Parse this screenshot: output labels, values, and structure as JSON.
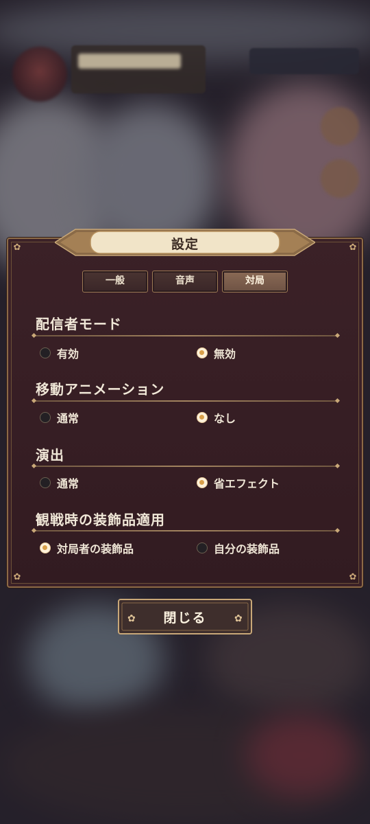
{
  "dialog": {
    "title": "設定",
    "tabs": [
      {
        "label": "一般",
        "active": false
      },
      {
        "label": "音声",
        "active": false
      },
      {
        "label": "対局",
        "active": true
      }
    ],
    "sections": [
      {
        "title": "配信者モード",
        "options": [
          {
            "label": "有効",
            "selected": false
          },
          {
            "label": "無効",
            "selected": true
          }
        ]
      },
      {
        "title": "移動アニメーション",
        "options": [
          {
            "label": "通常",
            "selected": false
          },
          {
            "label": "なし",
            "selected": true
          }
        ]
      },
      {
        "title": "演出",
        "options": [
          {
            "label": "通常",
            "selected": false
          },
          {
            "label": "省エフェクト",
            "selected": true
          }
        ]
      },
      {
        "title": "観戦時の装飾品適用",
        "options": [
          {
            "label": "対局者の装飾品",
            "selected": true
          },
          {
            "label": "自分の装飾品",
            "selected": false
          }
        ]
      }
    ],
    "close_label": "閉じる"
  },
  "colors": {
    "panel": "#3b2127",
    "border": "#8c6a46",
    "accent": "#d9a04a",
    "text": "#efe6d6"
  }
}
